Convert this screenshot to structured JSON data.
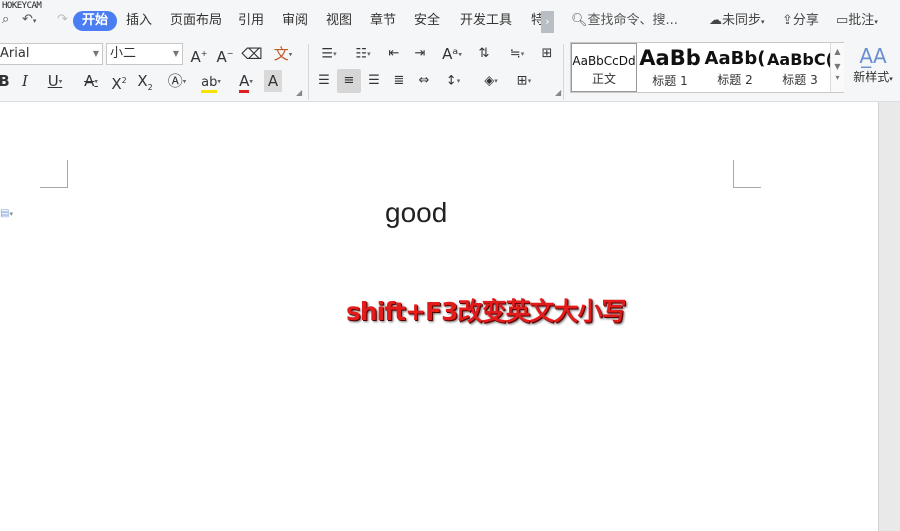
{
  "watermark": "HOKEYCAM",
  "menubar": {
    "tabs": [
      {
        "label": "开始",
        "active": true
      },
      {
        "label": "插入"
      },
      {
        "label": "页面布局"
      },
      {
        "label": "引用"
      },
      {
        "label": "审阅"
      },
      {
        "label": "视图"
      },
      {
        "label": "章节"
      },
      {
        "label": "安全"
      },
      {
        "label": "开发工具"
      },
      {
        "label": "特"
      }
    ],
    "search_placeholder": "查找命令、搜...",
    "sync_label": "未同步",
    "share_label": "分享",
    "comment_label": "批注"
  },
  "ribbon": {
    "font_name": "Arial",
    "font_size": "小二",
    "styles": [
      {
        "sample": "AaBbCcDd",
        "name": "正文"
      },
      {
        "sample": "AaBb",
        "name": "标题 1"
      },
      {
        "sample": "AaBb(",
        "name": "标题 2"
      },
      {
        "sample": "AaBbC(",
        "name": "标题 3"
      }
    ],
    "new_style_label": "新样式"
  },
  "document": {
    "text": "good",
    "overlay_caption": "shift+F3改变英文大小写"
  },
  "colors": {
    "accent": "#4a7ef2",
    "caption_red": "#e21b1b",
    "highlight_yellow": "#f5e400",
    "font_color_red": "#e02020"
  }
}
